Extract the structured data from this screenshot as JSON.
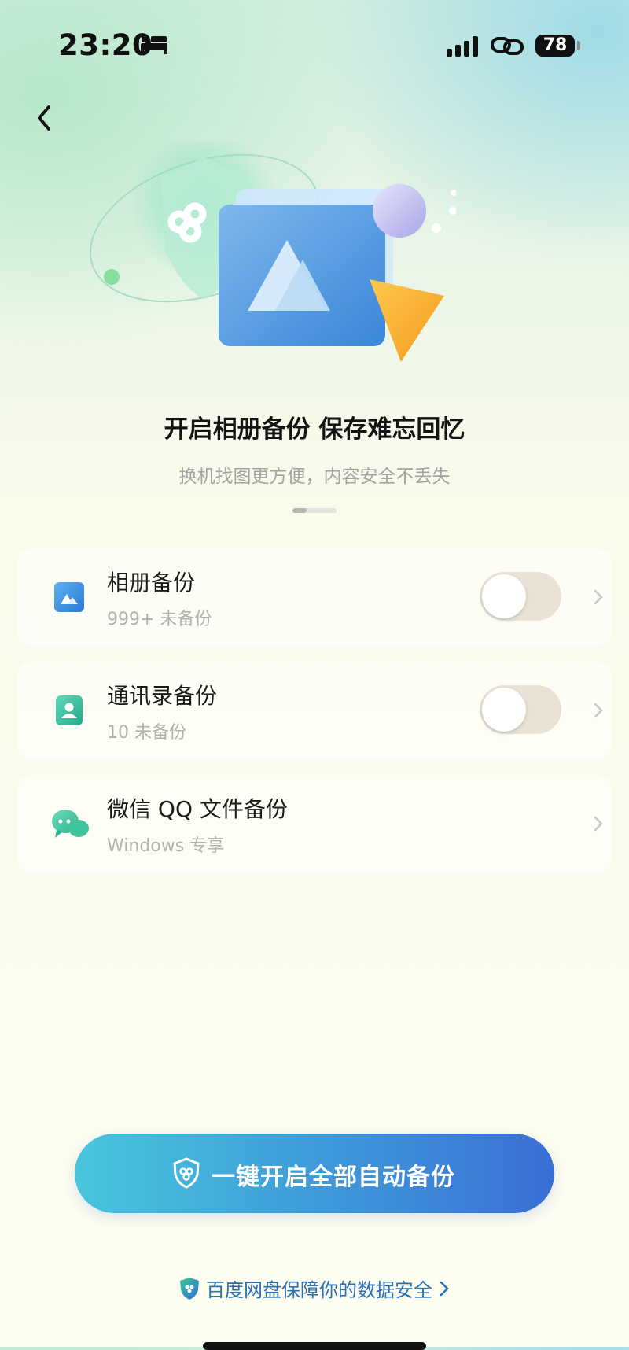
{
  "status_bar": {
    "time": "23:20",
    "battery": "78"
  },
  "page": {
    "title": "开启相册备份 保存难忘回忆",
    "subtitle": "换机找图更方便，内容安全不丢失"
  },
  "items": [
    {
      "label": "相册备份",
      "sub": "999+ 未备份",
      "toggle": false,
      "icon": "photo-album-icon"
    },
    {
      "label": "通讯录备份",
      "sub": "10 未备份",
      "toggle": false,
      "icon": "contacts-icon"
    },
    {
      "label": "微信 QQ 文件备份",
      "sub": "Windows 专享",
      "icon": "chat-bubbles-icon"
    }
  ],
  "cta": {
    "label": "一键开启全部自动备份"
  },
  "footer": {
    "label": "百度网盘保障你的数据安全"
  },
  "colors": {
    "accent_blue": "#3a6fd6",
    "accent_cyan": "#48c6dc",
    "link": "#2a6fb0"
  }
}
